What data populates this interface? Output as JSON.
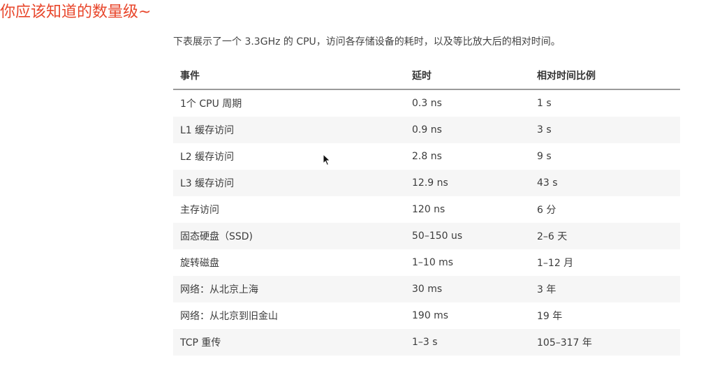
{
  "slide": {
    "title": "你应该知道的数量级~"
  },
  "intro": "下表展示了一个 3.3GHz 的 CPU，访问各存储设备的耗时，以及等比放大后的相对时间。",
  "table": {
    "headers": [
      "事件",
      "延时",
      "相对时间比例"
    ],
    "rows": [
      [
        "1个 CPU 周期",
        "0.3 ns",
        "1 s"
      ],
      [
        "L1 缓存访问",
        "0.9 ns",
        "3 s"
      ],
      [
        "L2 缓存访问",
        "2.8 ns",
        "9 s"
      ],
      [
        "L3 缓存访问",
        "12.9 ns",
        "43 s"
      ],
      [
        "主存访问",
        "120 ns",
        "6 分"
      ],
      [
        "固态硬盘（SSD)",
        "50–150 us",
        "2–6 天"
      ],
      [
        "旋转磁盘",
        "1–10 ms",
        "1–12 月"
      ],
      [
        "网络：从北京上海",
        "30 ms",
        "3 年"
      ],
      [
        "网络：从北京到旧金山",
        "190 ms",
        "19 年"
      ],
      [
        "TCP 重传",
        "1–3 s",
        "105–317 年"
      ]
    ]
  }
}
